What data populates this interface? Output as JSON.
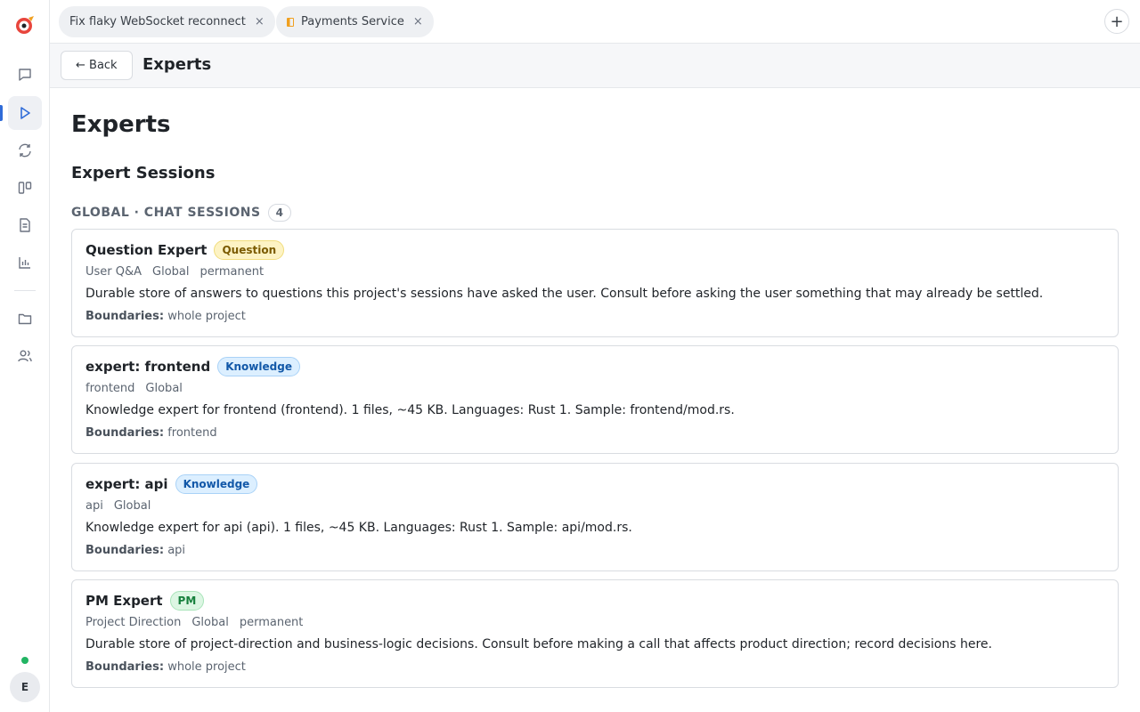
{
  "tabs": [
    {
      "label": "Fix flaky WebSocket reconnect",
      "close": "×"
    },
    {
      "label": "Payments Service",
      "close": "×"
    }
  ],
  "add_tab": "+",
  "subheader": {
    "back_label": "← Back",
    "title": "Experts"
  },
  "page": {
    "title": "Experts",
    "section_title": "Expert Sessions"
  },
  "group": {
    "label": "GLOBAL · CHAT SESSIONS",
    "count": "4"
  },
  "boundaries_label": "Boundaries:",
  "experts": [
    {
      "name": "Question Expert",
      "badge": "Question",
      "meta": [
        "User Q&A",
        "Global",
        "permanent"
      ],
      "description": "Durable store of answers to questions this project's sessions have asked the user. Consult before asking the user something that may already be settled.",
      "boundaries": "whole project"
    },
    {
      "name": "expert: frontend",
      "badge": "Knowledge",
      "meta": [
        "frontend",
        "Global"
      ],
      "description": "Knowledge expert for frontend (frontend). 1 files, ~45 KB. Languages: Rust 1. Sample: frontend/mod.rs.",
      "boundaries": "frontend"
    },
    {
      "name": "expert: api",
      "badge": "Knowledge",
      "meta": [
        "api",
        "Global"
      ],
      "description": "Knowledge expert for api (api). 1 files, ~45 KB. Languages: Rust 1. Sample: api/mod.rs.",
      "boundaries": "api"
    },
    {
      "name": "PM Expert",
      "badge": "PM",
      "meta": [
        "Project Direction",
        "Global",
        "permanent"
      ],
      "description": "Durable store of project-direction and business-logic decisions. Consult before making a call that affects product direction; record decisions here.",
      "boundaries": "whole project"
    }
  ],
  "user": {
    "initial": "E"
  }
}
